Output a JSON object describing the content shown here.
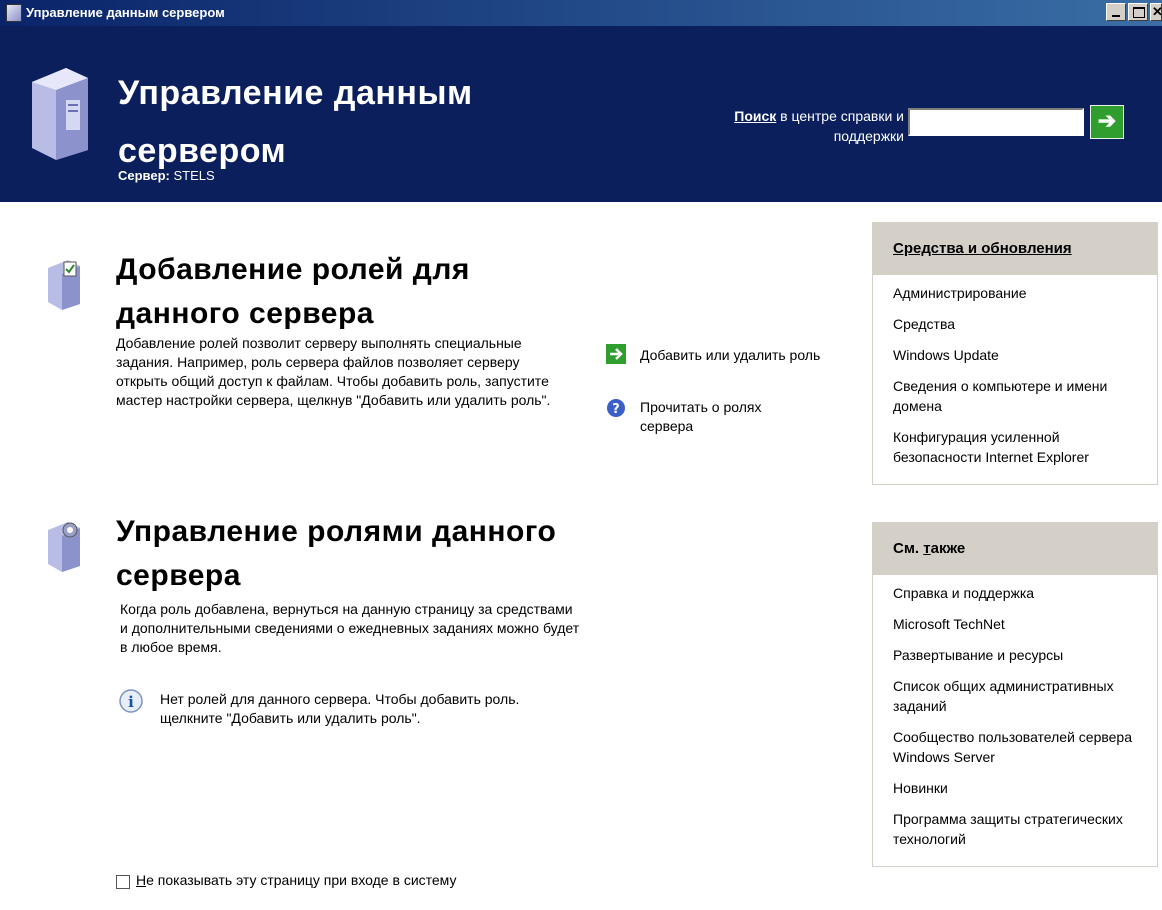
{
  "window": {
    "title": "Управление данным сервером"
  },
  "header": {
    "title": "Управление данным сервером",
    "server_label": "Сервер:",
    "server_name": "STELS",
    "search_label_bold": "Поиск",
    "search_label_rest": " в центре справки и поддержки",
    "search_value": ""
  },
  "sections": [
    {
      "title": "Добавление ролей для данного сервера",
      "text": "Добавление ролей позволит серверу выполнять специальные задания. Например, роль сервера файлов позволяет серверу открыть общий доступ к файлам. Чтобы добавить роль, запустите мастер настройки сервера, щелкнув \"Добавить или удалить роль\".",
      "actions": [
        {
          "label": "Добавить или удалить роль",
          "icon": "green-arrow-icon"
        },
        {
          "label": "Прочитать о ролях сервера",
          "icon": "help-icon"
        }
      ]
    },
    {
      "title": "Управление ролями данного сервера",
      "text": "Когда роль добавлена, вернуться на данную страницу за средствами и дополнительными сведениями о ежедневных заданиях можно будет в любое время.",
      "info": "Нет ролей для данного сервера. Чтобы добавить роль. щелкните \"Добавить или удалить роль\"."
    }
  ],
  "tools_panel": {
    "title": "Средства и обновления",
    "items": [
      "Администрирование",
      "Средства",
      "Windows Update",
      "Сведения о компьютере и имени домена",
      "Конфигурация усиленной безопасности Internet Explorer"
    ]
  },
  "see_also_panel": {
    "title_prefix": "См. ",
    "title_underlined": "т",
    "title_rest": "акже",
    "items": [
      "Справка и поддержка",
      "Microsoft TechNet",
      "Развертывание и ресурсы",
      "Список общих административных заданий",
      "Сообщество пользователей сервера Windows Server",
      "Новинки",
      "Программа защиты стратегических технологий"
    ]
  },
  "footer": {
    "checkbox_underlined": "Н",
    "checkbox_rest": "е показывать эту страницу при входе в систему",
    "checkbox_checked": false
  }
}
